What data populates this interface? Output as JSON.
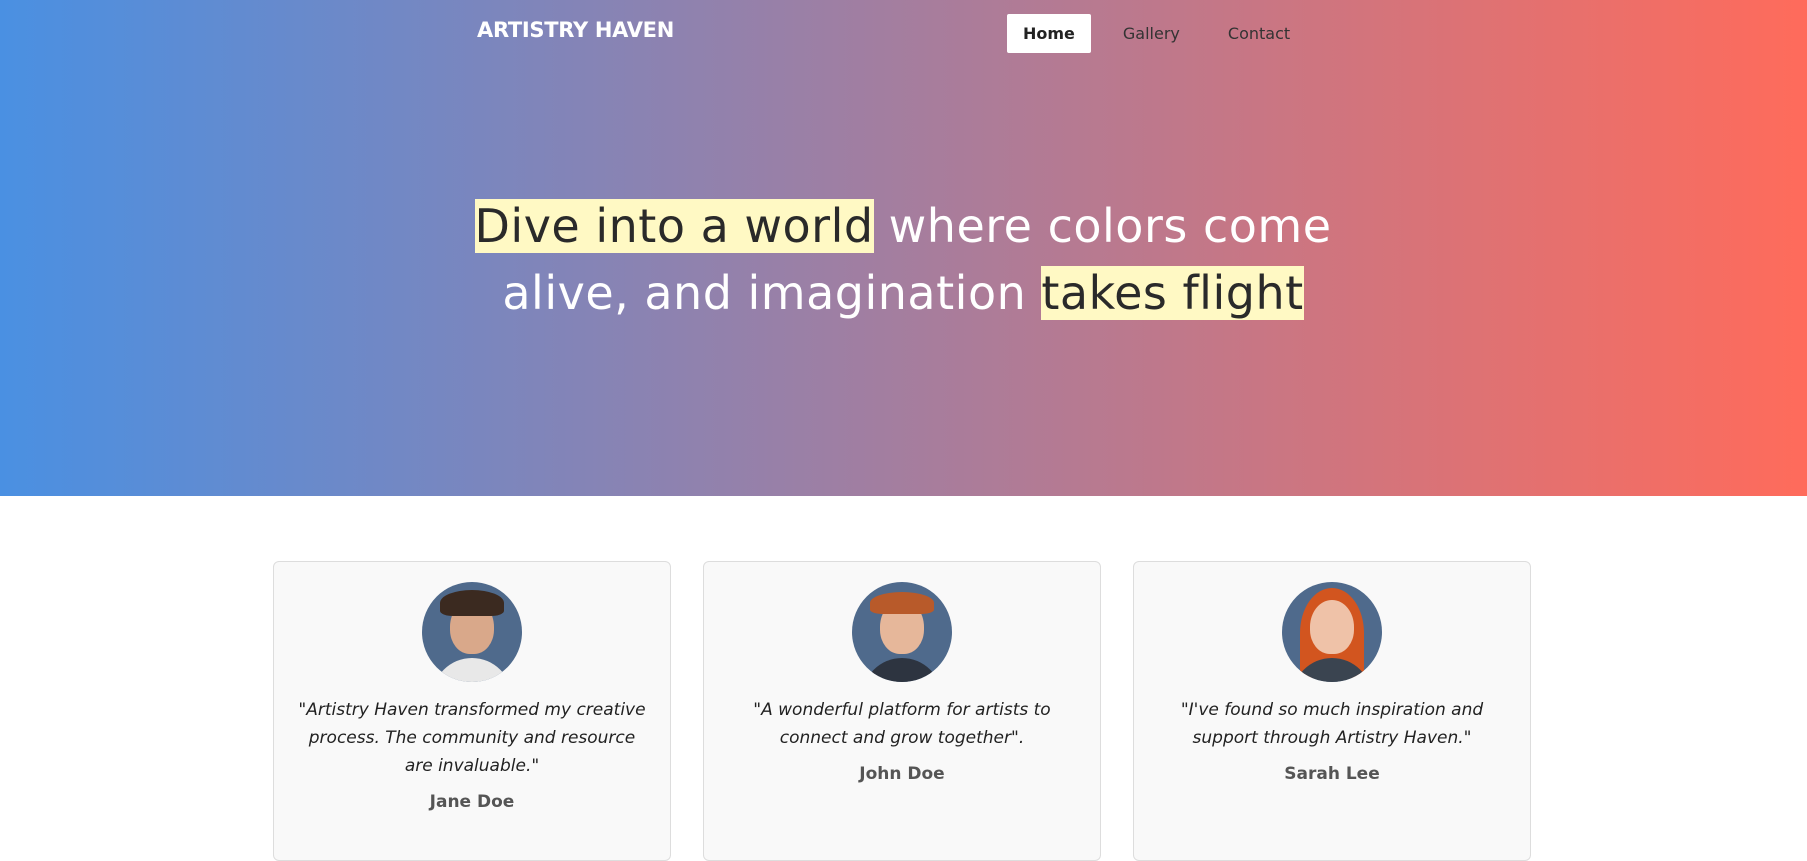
{
  "header": {
    "brand": "ARTISTRY HAVEN",
    "nav": [
      {
        "label": "Home",
        "active": true
      },
      {
        "label": "Gallery",
        "active": false
      },
      {
        "label": "Contact",
        "active": false
      }
    ]
  },
  "hero": {
    "headline_part1": "Dive into a world",
    "headline_part2": " where colors come alive, and imagination ",
    "headline_part3": "takes flight",
    "gradient_start": "#4a90e2",
    "gradient_end": "#ff6b5b",
    "highlight_color": "#fff9c4"
  },
  "testimonials": [
    {
      "quote": "\"Artistry Haven transformed my creative process. The community and resource are invaluable.\"",
      "name": "Jane Doe",
      "avatar_icon": "person-with-glasses-avatar"
    },
    {
      "quote": "\"A wonderful platform for artists to connect and grow together\".",
      "name": "John Doe",
      "avatar_icon": "person-avatar"
    },
    {
      "quote": "\"I've found so much inspiration and support through Artistry Haven.\"",
      "name": "Sarah Lee",
      "avatar_icon": "person-red-hair-avatar"
    }
  ]
}
